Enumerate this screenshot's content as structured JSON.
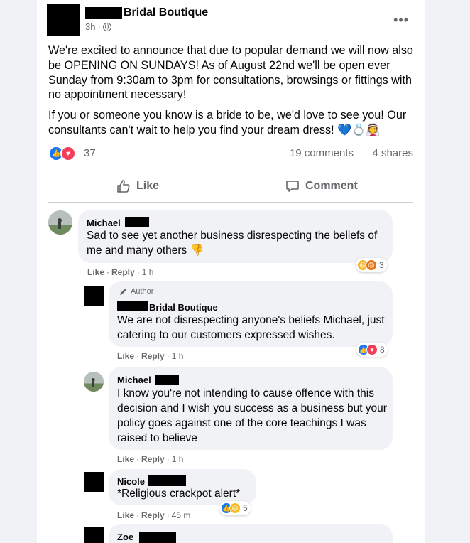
{
  "post": {
    "page_name": "Bridal Boutique",
    "time": "3h",
    "menu_icon": "more-options-icon",
    "paragraphs": [
      "We're excited to announce that due to popular demand we will now also be OPENING ON SUNDAYS! As of August 22nd we'll be open ever Sunday from 9:30am to 3pm for consultations, browsings or fittings with no appointment necessary!",
      "If you or someone you know is a bride to be, we'd love to see you! Our consultants can't wait to help you find your dream dress! 💙💍👰"
    ],
    "reaction_count": "37",
    "comments": "19 comments",
    "shares": "4 shares",
    "like_label": "Like",
    "comment_label": "Comment"
  },
  "comments": [
    {
      "name": "Michael",
      "text": "Sad to see yet another business disrespecting the beliefs of me and many others 👎",
      "like": "Like",
      "reply": "Reply",
      "time": "1 h",
      "reactions": "3"
    },
    {
      "badge": "Author",
      "name": "Bridal Boutique",
      "text": "We are not disrespecting anyone's beliefs Michael, just catering to our customers expressed wishes.",
      "like": "Like",
      "reply": "Reply",
      "time": "1 h",
      "reactions": "8"
    },
    {
      "name": "Michael",
      "text": "I know you're not intending to cause offence with this decision and I wish you success as a business but your policy goes against one of the core teachings I was raised to believe",
      "like": "Like",
      "reply": "Reply",
      "time": "1 h"
    },
    {
      "name": "Nicole",
      "text": "*Religious crackpot alert*",
      "like": "Like",
      "reply": "Reply",
      "time": "45 m",
      "reactions": "5"
    },
    {
      "name": "Zoe"
    }
  ],
  "colors": {
    "background": "#f0f2f5",
    "card": "#ffffff",
    "like_blue": "#1877f2",
    "love_red": "#f33e58",
    "secondary_text": "#65676b"
  }
}
